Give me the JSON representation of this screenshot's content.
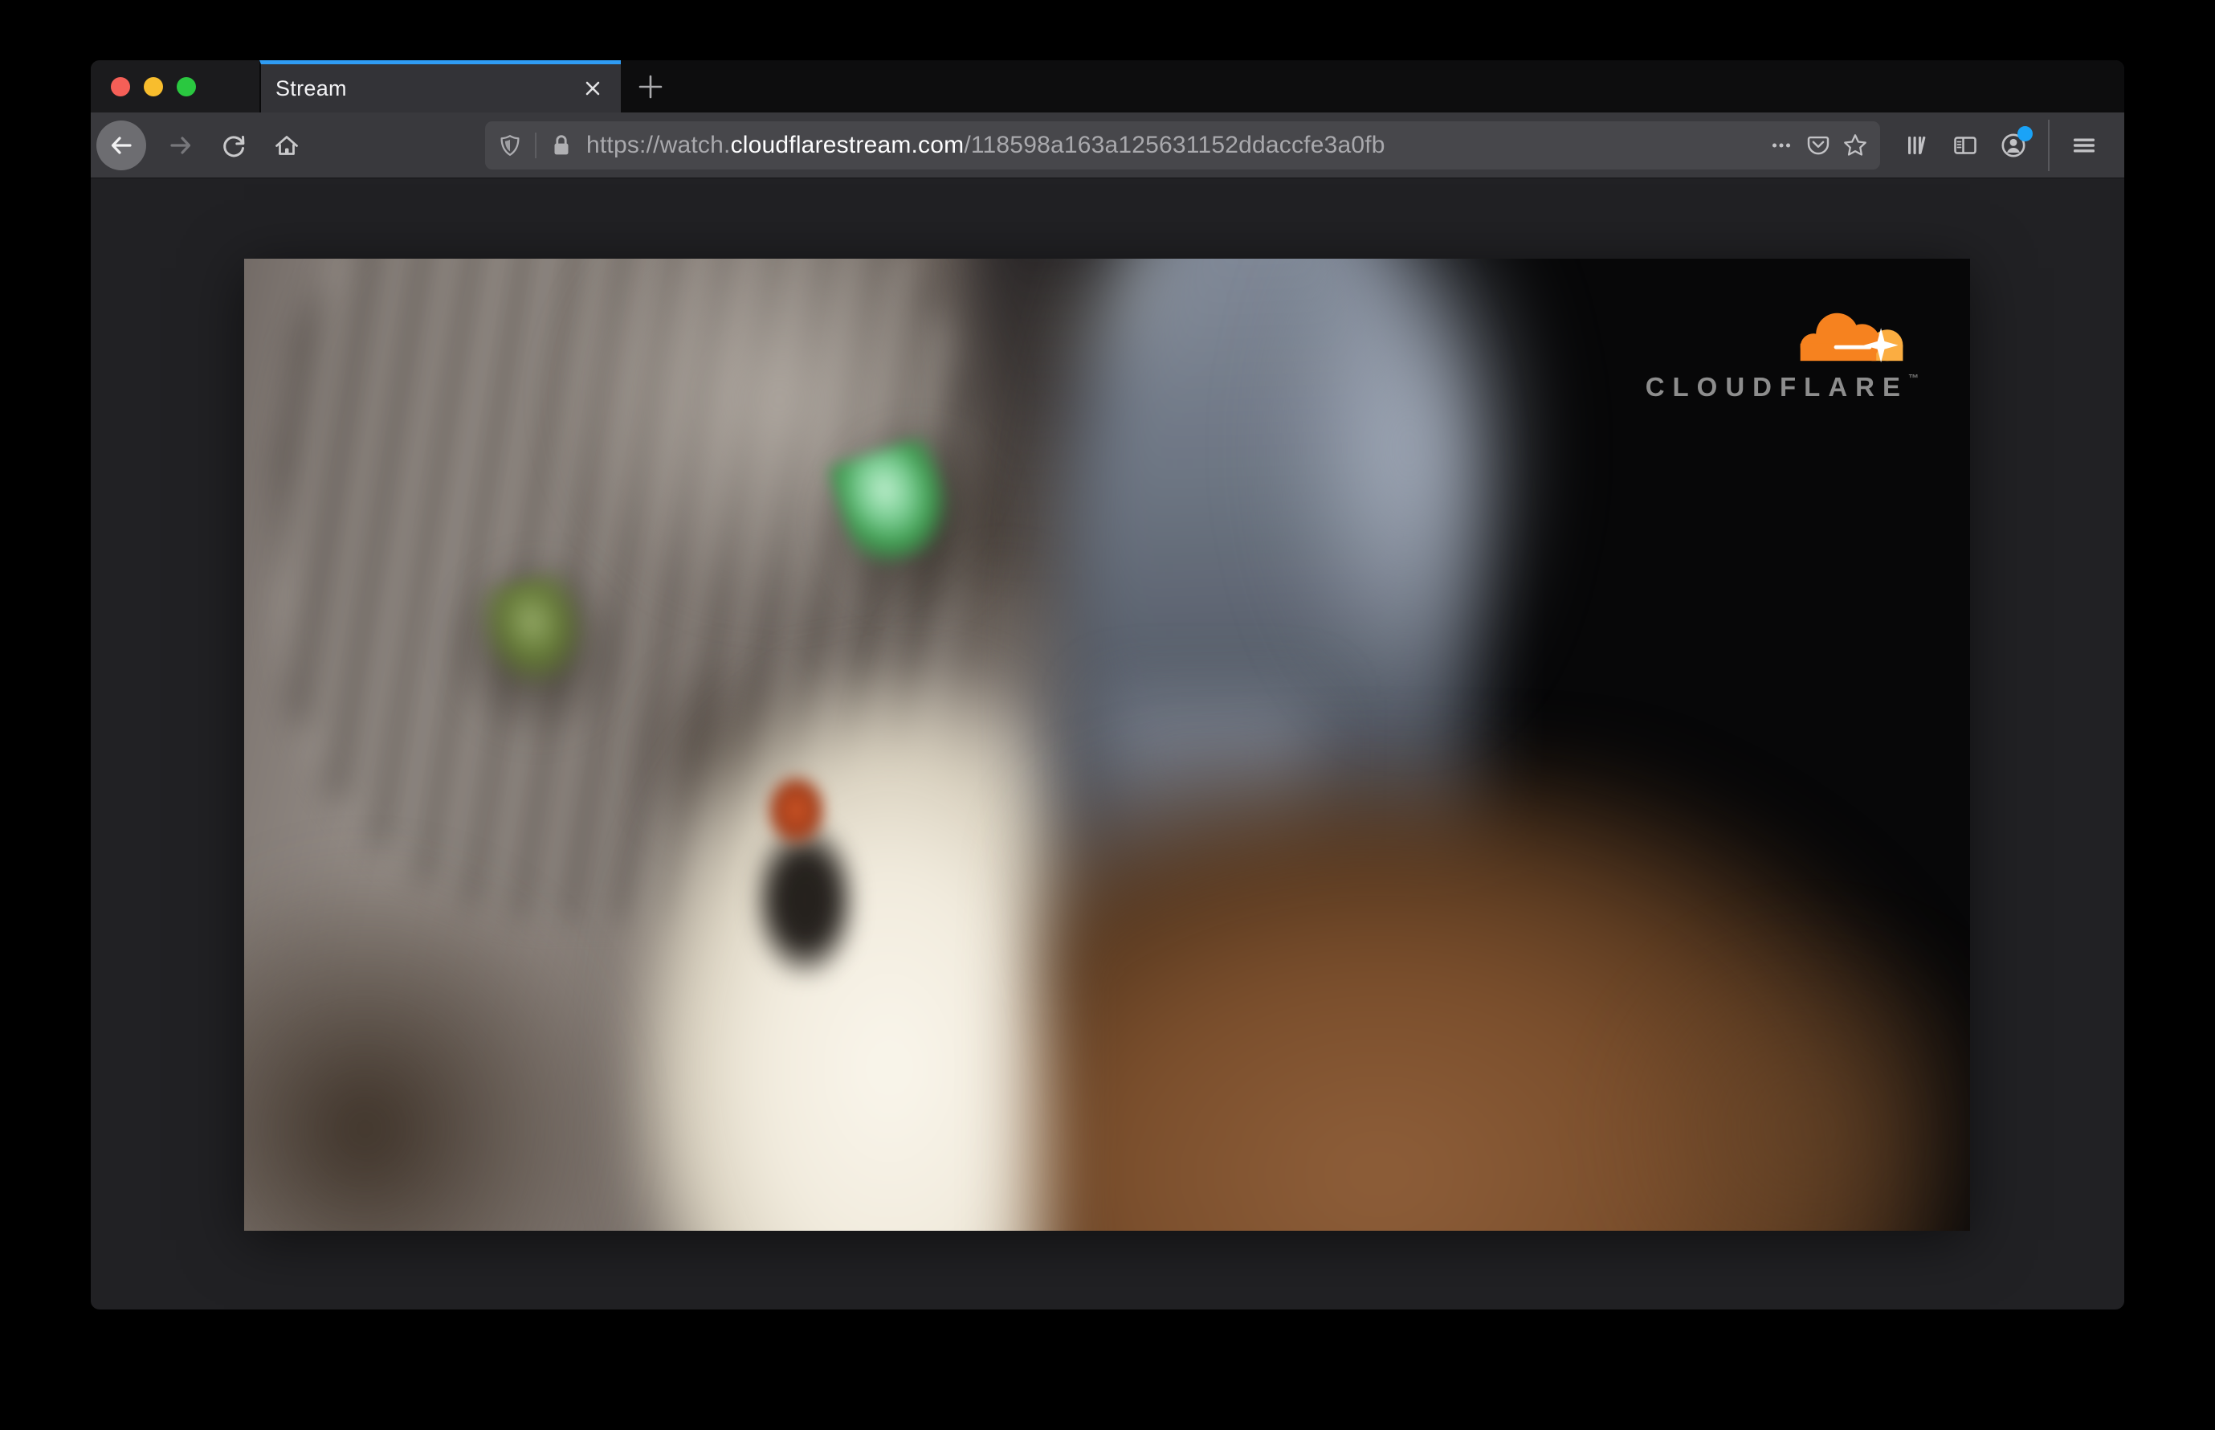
{
  "tab_bar": {
    "active_tab": {
      "title": "Stream",
      "close_icon": "x-icon"
    },
    "new_tab_icon": "plus-icon"
  },
  "window_controls": {
    "close_icon": "red-traffic-light",
    "minimize_icon": "yellow-traffic-light",
    "zoom_icon": "green-traffic-light"
  },
  "toolbar": {
    "back_icon": "arrow-left-icon",
    "forward_icon": "arrow-right-icon",
    "reload_icon": "reload-icon",
    "home_icon": "home-icon",
    "address_bar": {
      "shield_icon": "tracking-protection-shield-icon",
      "lock_icon": "padlock-icon",
      "prefix": "https://watch.",
      "host": "cloudflarestream.com",
      "path": "/118598a163a125631152ddaccfe3a0fb",
      "page_actions_icon": "ellipsis-icon",
      "pocket_icon": "pocket-save-icon",
      "bookmark_icon": "star-icon"
    },
    "library_icon": "library-icon",
    "sidebar_icon": "sidebar-toggle-icon",
    "account_icon": "account-icon",
    "account_has_notification_dot": true,
    "menu_icon": "hamburger-menu-icon"
  },
  "content": {
    "video_player": {
      "watermark": {
        "text": "CLOUDFLARE",
        "tm": "™"
      }
    }
  },
  "colors": {
    "tab_accent_stripe": "#2f9cf4",
    "notification_dot": "#1aa3f7",
    "cloudflare_orange": "#f6821f",
    "cloudflare_light_orange": "#fbad41",
    "traffic_red": "#f55f57",
    "traffic_yellow": "#f8bd2d",
    "traffic_green": "#2ac840"
  }
}
